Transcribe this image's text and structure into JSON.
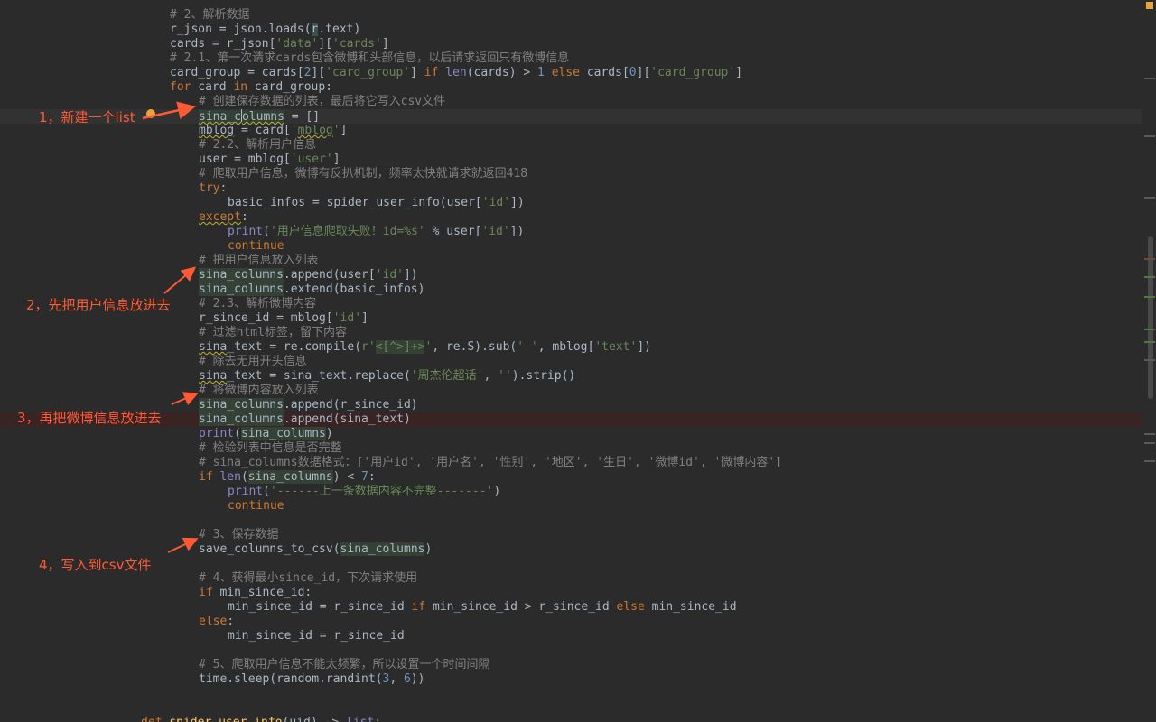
{
  "annotations": {
    "note1": "1，新建一个list",
    "note2": "2，先把用户信息放进去",
    "note3": "3，再把微博信息放进去",
    "note4": "4，写入到csv文件"
  },
  "code": {
    "c_parse": "# 2、解析数据",
    "c_first_request": "# 2.1、第一次请求cards包含微博和头部信息，以后请求返回只有微博信息",
    "c_create_list": "# 创建保存数据的列表，最后将它写入csv文件",
    "c_parse_user": "# 2.2、解析用户信息",
    "c_crawl_user": "# 爬取用户信息，微博有反扒机制，频率太快就请求就返回418",
    "s_user_fail": "'用户信息爬取失败！id=%s'",
    "c_add_user": "# 把用户信息放入列表",
    "c_parse_weibo": "# 2.3、解析微博内容",
    "c_filter_html": "# 过滤html标签，留下内容",
    "c_remove_head": "# 除去无用开头信息",
    "s_topic": "'周杰伦超话'",
    "c_add_weibo": "# 将微博内容放入列表",
    "c_check": "# 检验列表中信息是否完整",
    "c_format": "# sina_columns数据格式：['用户id', '用户名', '性别', '地区', '生日', '微博id', '微博内容']",
    "s_incomplete": "'------上一条数据内容不完整-------'",
    "c_save": "# 3、保存数据",
    "c_min_since": "# 4、获得最小since_id，下次请求使用",
    "c_sleep": "# 5、爬取用户信息不能太频繁，所以设置一个时间间隔"
  },
  "colors": {
    "background": "#2b2b2b",
    "annotation": "#ff5a36",
    "keyword": "#cc7832",
    "string": "#6a8759",
    "comment": "#808080",
    "number": "#6897bb",
    "builtin": "#8888c6"
  }
}
